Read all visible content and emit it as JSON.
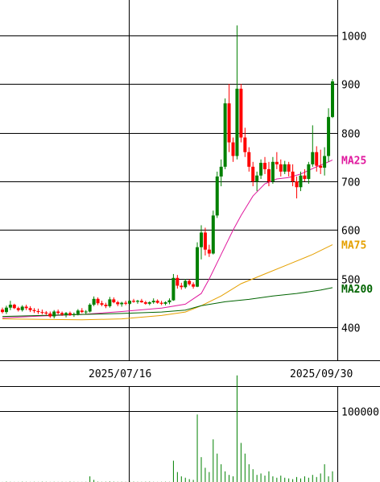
{
  "chart_data": [
    {
      "type": "candlestick",
      "panel": "price",
      "ylim": [
        333,
        1072
      ],
      "yticks": [
        400,
        500,
        600,
        700,
        800,
        900,
        1000
      ],
      "xtick_labels": [
        "2025/07/16",
        "2025/09/30"
      ],
      "grid": true,
      "up_color": "#008000",
      "down_color": "#ff0000",
      "candles": [
        [
          437,
          441,
          429,
          432
        ],
        [
          432,
          445,
          428,
          441
        ],
        [
          441,
          455,
          436,
          447
        ],
        [
          447,
          449,
          438,
          440
        ],
        [
          440,
          443,
          433,
          436
        ],
        [
          436,
          446,
          433,
          443
        ],
        [
          443,
          447,
          436,
          440
        ],
        [
          440,
          444,
          432,
          436
        ],
        [
          436,
          440,
          430,
          434
        ],
        [
          434,
          439,
          428,
          432
        ],
        [
          432,
          437,
          427,
          431
        ],
        [
          431,
          434,
          426,
          429
        ],
        [
          429,
          433,
          420,
          423
        ],
        [
          423,
          436,
          419,
          433
        ],
        [
          433,
          437,
          427,
          430
        ],
        [
          430,
          433,
          424,
          427
        ],
        [
          427,
          432,
          421,
          430
        ],
        [
          430,
          433,
          424,
          426
        ],
        [
          426,
          431,
          422,
          428
        ],
        [
          428,
          438,
          425,
          435
        ],
        [
          435,
          440,
          430,
          432
        ],
        [
          432,
          436,
          428,
          433
        ],
        [
          433,
          450,
          431,
          447
        ],
        [
          447,
          464,
          444,
          459
        ],
        [
          459,
          462,
          446,
          450
        ],
        [
          450,
          455,
          444,
          447
        ],
        [
          447,
          451,
          440,
          444
        ],
        [
          444,
          463,
          441,
          458
        ],
        [
          458,
          462,
          450,
          452
        ],
        [
          452,
          455,
          444,
          448
        ],
        [
          448,
          453,
          443,
          451
        ],
        [
          451,
          455,
          446,
          449
        ],
        [
          449,
          456,
          447,
          455
        ],
        [
          455,
          459,
          451,
          453
        ],
        [
          453,
          457,
          449,
          455
        ],
        [
          455,
          459,
          451,
          452
        ],
        [
          452,
          455,
          447,
          449
        ],
        [
          449,
          454,
          446,
          452
        ],
        [
          452,
          460,
          449,
          455
        ],
        [
          455,
          458,
          449,
          451
        ],
        [
          451,
          455,
          446,
          449
        ],
        [
          449,
          454,
          446,
          452
        ],
        [
          452,
          460,
          448,
          456
        ],
        [
          456,
          510,
          455,
          502
        ],
        [
          502,
          508,
          480,
          486
        ],
        [
          486,
          492,
          478,
          483
        ],
        [
          483,
          500,
          480,
          496
        ],
        [
          496,
          499,
          486,
          489
        ],
        [
          489,
          493,
          480,
          484
        ],
        [
          484,
          575,
          483,
          565
        ],
        [
          565,
          610,
          540,
          595
        ],
        [
          595,
          605,
          548,
          560
        ],
        [
          560,
          570,
          545,
          552
        ],
        [
          552,
          640,
          550,
          630
        ],
        [
          630,
          720,
          625,
          710
        ],
        [
          710,
          745,
          690,
          730
        ],
        [
          730,
          870,
          725,
          860
        ],
        [
          860,
          900,
          760,
          780
        ],
        [
          780,
          790,
          740,
          752
        ],
        [
          752,
          1020,
          745,
          890
        ],
        [
          890,
          900,
          780,
          790
        ],
        [
          790,
          810,
          750,
          760
        ],
        [
          760,
          770,
          720,
          730
        ],
        [
          730,
          740,
          690,
          700
        ],
        [
          700,
          720,
          680,
          712
        ],
        [
          712,
          745,
          705,
          738
        ],
        [
          738,
          750,
          715,
          725
        ],
        [
          725,
          740,
          690,
          700
        ],
        [
          700,
          750,
          695,
          740
        ],
        [
          740,
          760,
          725,
          735
        ],
        [
          735,
          745,
          710,
          720
        ],
        [
          720,
          742,
          715,
          735
        ],
        [
          735,
          740,
          710,
          720
        ],
        [
          720,
          735,
          690,
          700
        ],
        [
          700,
          710,
          665,
          688
        ],
        [
          688,
          720,
          680,
          712
        ],
        [
          712,
          725,
          700,
          705
        ],
        [
          705,
          740,
          695,
          735
        ],
        [
          735,
          815,
          730,
          760
        ],
        [
          760,
          772,
          720,
          732
        ],
        [
          732,
          765,
          715,
          728
        ],
        [
          728,
          770,
          712,
          752
        ],
        [
          752,
          850,
          740,
          832
        ],
        [
          832,
          910,
          830,
          905
        ]
      ],
      "series": [
        {
          "name": "MA25",
          "color": "#e0199e",
          "labeled_value": 744,
          "points": [
            [
              0,
              420
            ],
            [
              10,
              424
            ],
            [
              20,
              427
            ],
            [
              30,
              433
            ],
            [
              40,
              440
            ],
            [
              46,
              448
            ],
            [
              50,
              470
            ],
            [
              52,
              500
            ],
            [
              55,
              550
            ],
            [
              58,
              600
            ],
            [
              60,
              630
            ],
            [
              63,
              670
            ],
            [
              66,
              695
            ],
            [
              69,
              705
            ],
            [
              72,
              708
            ],
            [
              75,
              715
            ],
            [
              79,
              730
            ],
            [
              82,
              740
            ],
            [
              83,
              744
            ]
          ]
        },
        {
          "name": "MA75",
          "color": "#e5a000",
          "labeled_value": 570,
          "points": [
            [
              0,
              418
            ],
            [
              10,
              417
            ],
            [
              20,
              416
            ],
            [
              30,
              418
            ],
            [
              40,
              425
            ],
            [
              46,
              432
            ],
            [
              50,
              445
            ],
            [
              55,
              465
            ],
            [
              60,
              490
            ],
            [
              66,
              510
            ],
            [
              72,
              530
            ],
            [
              78,
              550
            ],
            [
              83,
              570
            ]
          ]
        },
        {
          "name": "MA200",
          "color": "#006400",
          "labeled_value": 480,
          "points": [
            [
              0,
              423
            ],
            [
              10,
              425
            ],
            [
              20,
              427
            ],
            [
              30,
              429
            ],
            [
              40,
              432
            ],
            [
              46,
              436
            ],
            [
              50,
              445
            ],
            [
              56,
              453
            ],
            [
              62,
              458
            ],
            [
              68,
              465
            ],
            [
              74,
              470
            ],
            [
              80,
              477
            ],
            [
              83,
              482
            ]
          ]
        }
      ]
    },
    {
      "type": "bar",
      "panel": "volume",
      "ylim": [
        0,
        135000
      ],
      "yticks": [
        100000
      ],
      "ytick_labels": [
        "100000"
      ],
      "color": "#008000",
      "values": [
        200,
        500,
        300,
        200,
        200,
        400,
        300,
        200,
        300,
        200,
        400,
        300,
        200,
        300,
        200,
        300,
        200,
        500,
        300,
        200,
        200,
        300,
        8000,
        3000,
        500,
        300,
        400,
        700,
        500,
        300,
        400,
        300,
        700,
        500,
        300,
        300,
        400,
        500,
        300,
        200,
        300,
        400,
        300,
        30000,
        14000,
        8000,
        6000,
        4000,
        3000,
        95000,
        35000,
        20000,
        14000,
        60000,
        40000,
        25000,
        15000,
        10000,
        8000,
        150000,
        55000,
        40000,
        25000,
        18000,
        10000,
        12000,
        9000,
        15000,
        8000,
        6000,
        9000,
        6000,
        5000,
        4000,
        7000,
        5000,
        8000,
        6000,
        10000,
        7000,
        12000,
        25000,
        8000,
        15000
      ]
    }
  ]
}
